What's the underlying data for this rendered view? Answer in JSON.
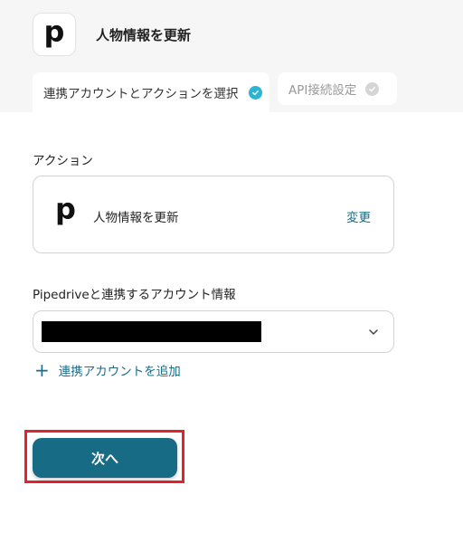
{
  "header": {
    "logo_letter": "p",
    "title": "人物情報を更新"
  },
  "tabs": [
    {
      "label": "連携アカウントとアクションを選択",
      "state": "active",
      "icon": "check-circle-icon"
    },
    {
      "label": "API接続設定",
      "state": "inactive",
      "icon": "check-circle-icon"
    }
  ],
  "action_section": {
    "label": "アクション",
    "card": {
      "logo_letter": "p",
      "name": "人物情報を更新",
      "change_label": "変更"
    }
  },
  "account_section": {
    "label": "Pipedriveと連携するアカウント情報",
    "selected_value": "",
    "dropdown_icon": "chevron-down-icon",
    "add_link": "連携アカウントを追加",
    "add_icon": "plus-icon"
  },
  "next_button": {
    "label": "次へ"
  },
  "colors": {
    "accent": "#176b85",
    "link": "#1a6d86",
    "active_check": "#2bb5d2",
    "highlight": "#e2222c"
  }
}
